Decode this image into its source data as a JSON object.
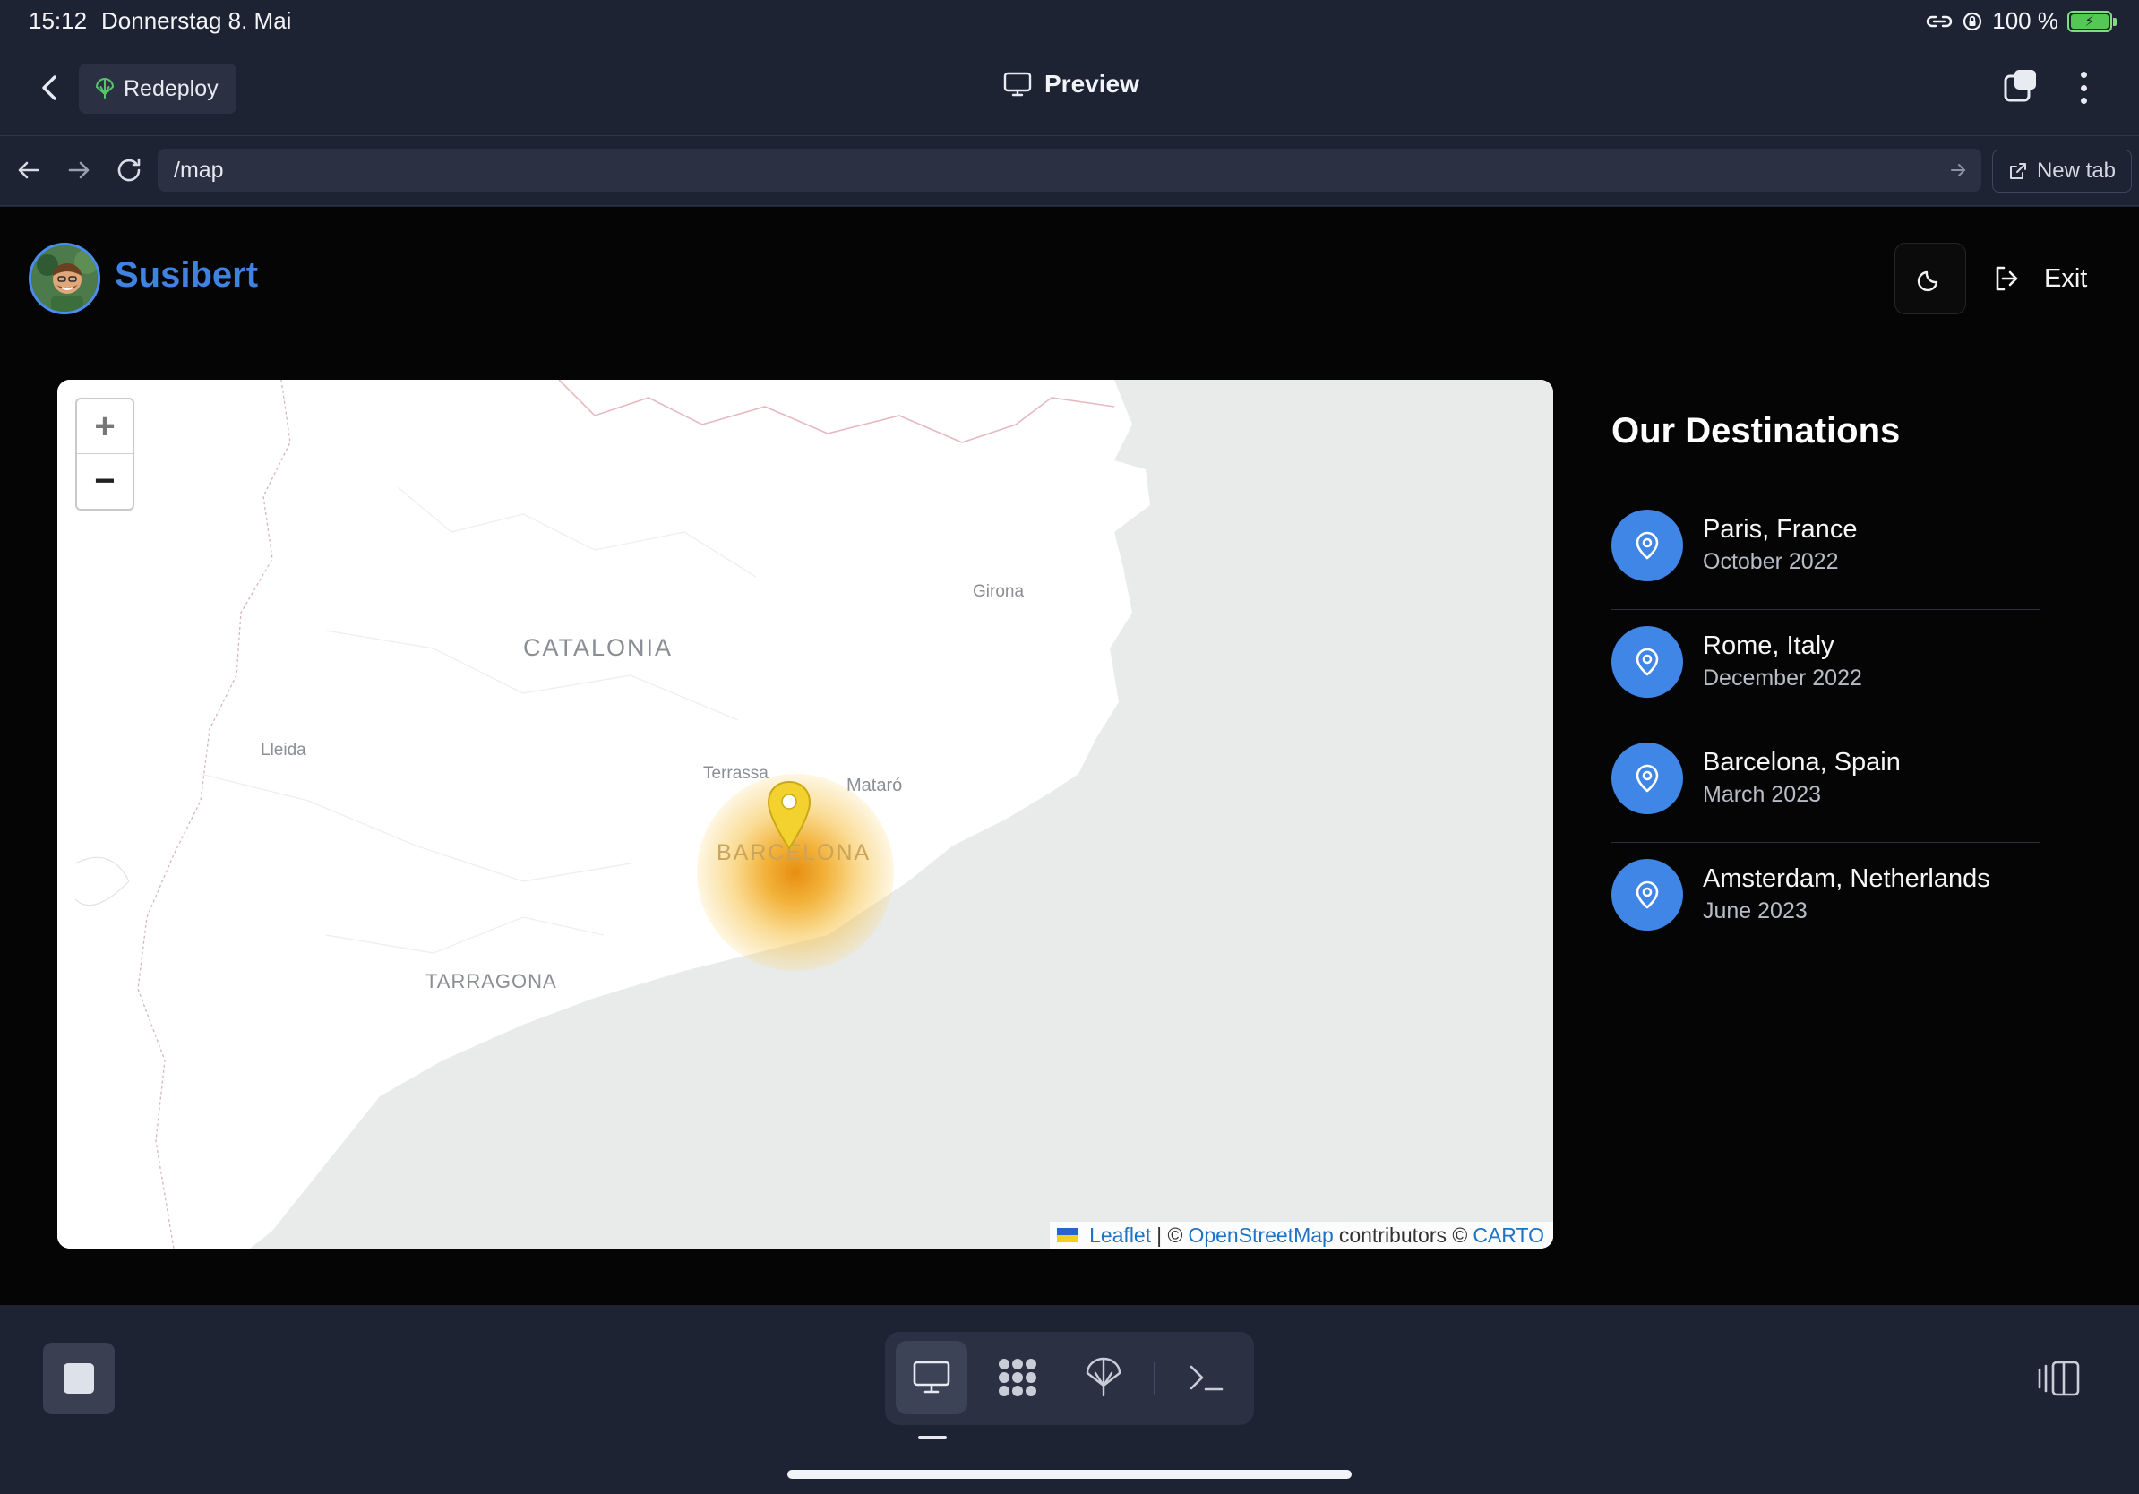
{
  "status_bar": {
    "time": "15:12",
    "date": "Donnerstag 8. Mai",
    "battery": "100 %"
  },
  "toolbar": {
    "redeploy_label": "Redeploy",
    "title": "Preview"
  },
  "url_bar": {
    "url": "/map",
    "new_tab_label": "New tab"
  },
  "site": {
    "brand": "Susibert",
    "exit_label": "Exit"
  },
  "map": {
    "labels": {
      "catalonia": "CATALONIA",
      "girona": "Girona",
      "lleida": "Lleida",
      "terrassa": "Terrassa",
      "mataro": "Mataró",
      "barcelona": "BARCELONA",
      "tarragona": "TARRAGONA"
    },
    "zoom_in": "+",
    "zoom_out": "−",
    "attribution": {
      "leaflet": "Leaflet",
      "sep": "| ©",
      "osm": "OpenStreetMap",
      "contributors": "contributors ©",
      "carto": "CARTO"
    },
    "marker_color": "#f3d230"
  },
  "destinations": {
    "title": "Our Destinations",
    "items": [
      {
        "name": "Paris, France",
        "date": "October 2022"
      },
      {
        "name": "Rome, Italy",
        "date": "December 2022"
      },
      {
        "name": "Barcelona, Spain",
        "date": "March 2023"
      },
      {
        "name": "Amsterdam, Netherlands",
        "date": "June 2023"
      }
    ]
  },
  "colors": {
    "accent_blue": "#3f86e6",
    "app_chrome": "#1e2333",
    "page_bg": "#050505"
  }
}
